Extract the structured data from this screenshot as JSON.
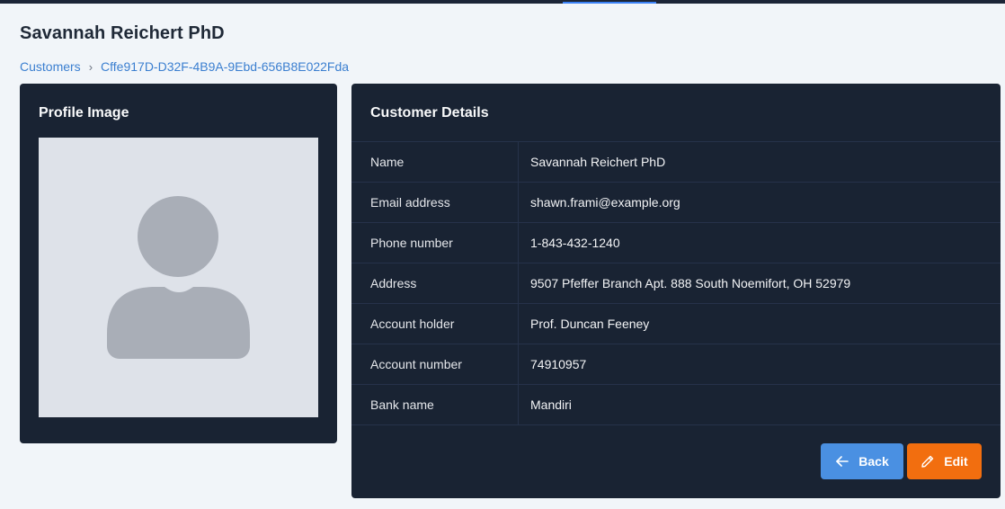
{
  "page": {
    "title": "Savannah Reichert PhD"
  },
  "breadcrumb": {
    "items": [
      {
        "label": "Customers"
      },
      {
        "label": "Cffe917D-D32F-4B9A-9Ebd-656B8E022Fda"
      }
    ],
    "separator": "›"
  },
  "profile": {
    "title": "Profile Image",
    "avatar_icon": "user-silhouette-icon"
  },
  "details": {
    "title": "Customer Details",
    "rows": [
      {
        "label": "Name",
        "value": "Savannah Reichert PhD"
      },
      {
        "label": "Email address",
        "value": "shawn.frami@example.org"
      },
      {
        "label": "Phone number",
        "value": "1-843-432-1240"
      },
      {
        "label": "Address",
        "value": "9507 Pfeffer Branch Apt. 888 South Noemifort, OH 52979"
      },
      {
        "label": "Account holder",
        "value": "Prof. Duncan Feeney"
      },
      {
        "label": "Account number",
        "value": "74910957"
      },
      {
        "label": "Bank name",
        "value": "Mandiri"
      }
    ]
  },
  "actions": {
    "back_label": "Back",
    "back_icon": "arrow-left-icon",
    "edit_label": "Edit",
    "edit_icon": "pencil-icon"
  },
  "colors": {
    "card_bg": "#192333",
    "page_bg": "#f1f5f9",
    "link": "#3b7fd0",
    "back_button": "#4a90e2",
    "edit_button": "#f26e0f"
  }
}
